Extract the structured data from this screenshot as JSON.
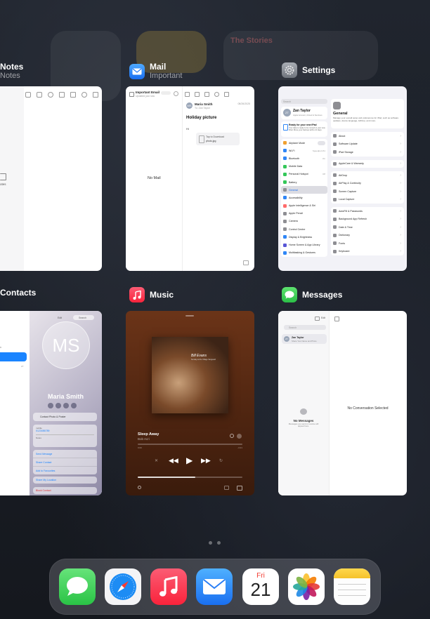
{
  "apps": {
    "notes": {
      "title": "Notes",
      "subtitle": "Notes",
      "snippet": "otes"
    },
    "mail": {
      "title": "Mail",
      "subtitle": "Important",
      "mailbox_title": "Important Email",
      "mailbox_sub": "Updated just now",
      "empty_text": "No Mail",
      "sender": "Maria Smith",
      "to": "To: Zan Taylor",
      "date": "08/26/2025",
      "subject": "Holiday picture",
      "greeting": "Hi",
      "attachment_title": "Tap to Download",
      "attachment_sub": "photo.jpg"
    },
    "settings": {
      "title": "Settings",
      "search_placeholder": "Search",
      "profile_name": "Zan Taylor",
      "profile_sub": "Apple Account, iCloud & Services",
      "banner_title": "Ready for your new iPad",
      "banner_text": "Your data is ready to be moved to your new iPad. Move your backup within 21 days.",
      "items": [
        {
          "label": "Airplane Mode",
          "color": "#f0a030",
          "trail": "toggle"
        },
        {
          "label": "Wi-Fi",
          "color": "#2f86f6",
          "trail": "Speedport-51"
        },
        {
          "label": "Bluetooth",
          "color": "#2f86f6",
          "trail": "On"
        },
        {
          "label": "Mobile Data",
          "color": "#34c759",
          "trail": ""
        },
        {
          "label": "Personal Hotspot",
          "color": "#34c759",
          "trail": "Off"
        },
        {
          "label": "Battery",
          "color": "#34c759",
          "trail": ""
        },
        {
          "label": "General",
          "color": "#8e8e93",
          "trail": "",
          "selected": true
        },
        {
          "label": "Accessibility",
          "color": "#2f86f6",
          "trail": ""
        },
        {
          "label": "Apple Intelligence & Siri",
          "color": "#ff6b6b",
          "trail": ""
        },
        {
          "label": "Apple Pencil",
          "color": "#8e8e93",
          "trail": ""
        },
        {
          "label": "Camera",
          "color": "#8e8e93",
          "trail": ""
        },
        {
          "label": "Control Centre",
          "color": "#8e8e93",
          "trail": ""
        },
        {
          "label": "Display & Brightness",
          "color": "#2f86f6",
          "trail": ""
        },
        {
          "label": "Home Screen & App Library",
          "color": "#5856d6",
          "trail": ""
        },
        {
          "label": "Multitasking & Gestures",
          "color": "#2f86f6",
          "trail": ""
        }
      ],
      "detail_title": "General",
      "detail_text": "Manage your overall setup and preferences for iPad, such as software updates, device language, AirDrop, and more.",
      "detail_groups": [
        [
          "About",
          "Software Update",
          "iPad Storage"
        ],
        [
          "AppleCare & Warranty"
        ],
        [
          "AirDrop",
          "AirPlay & Continuity",
          "Screen Capture",
          "Local Capture"
        ],
        [
          "AutoFill & Passwords",
          "Background App Refresh",
          "Date & Time",
          "Dictionary",
          "Fonts",
          "Keyboard"
        ]
      ]
    },
    "contacts": {
      "title": "Contacts",
      "initials": "MS",
      "name": "Maria Smith",
      "photo_row": "Contact Photo & Poster",
      "mobile_label": "mobile",
      "mobile_value": "0123456789",
      "notes_label": "Notes",
      "actions": [
        "Send Message",
        "Share Contact",
        "Add to Favourites"
      ],
      "location": "Share My Location",
      "block": "Block Contact",
      "edit": "Edit",
      "search": "Search"
    },
    "music": {
      "title": "Music",
      "album_title": "Bill Evans",
      "album_sub": "Sunday at the Village Vanguard",
      "track": "Sleep Away",
      "artist": "Bob Acri",
      "elapsed": "0:00",
      "remaining": "-3:21"
    },
    "messages": {
      "title": "Messages",
      "edit": "Edit",
      "search": "Search",
      "contact_name": "Zan Taylor",
      "contact_sub": "Share Your Name and Photo",
      "empty_title": "No Messages",
      "empty_text": "Messages you send or receive will appear here.",
      "no_selection": "No Conversation Selected"
    }
  },
  "dock": [
    {
      "name": "Messages",
      "icon": "messages-icon"
    },
    {
      "name": "Safari",
      "icon": "safari-icon"
    },
    {
      "name": "Music",
      "icon": "music-icon"
    },
    {
      "name": "Mail",
      "icon": "mail-icon"
    },
    {
      "name": "Calendar",
      "icon": "calendar-icon",
      "day": "Fri",
      "date": "21"
    },
    {
      "name": "Photos",
      "icon": "photos-icon"
    },
    {
      "name": "Notes",
      "icon": "notes-icon"
    }
  ],
  "colors": {
    "accent": "#007aff",
    "messages_green": "#34c759",
    "music_red": "#fa2d48",
    "mail_blue": "#1e7df5"
  },
  "background_widgets": {
    "stories_title": "The Stories"
  }
}
